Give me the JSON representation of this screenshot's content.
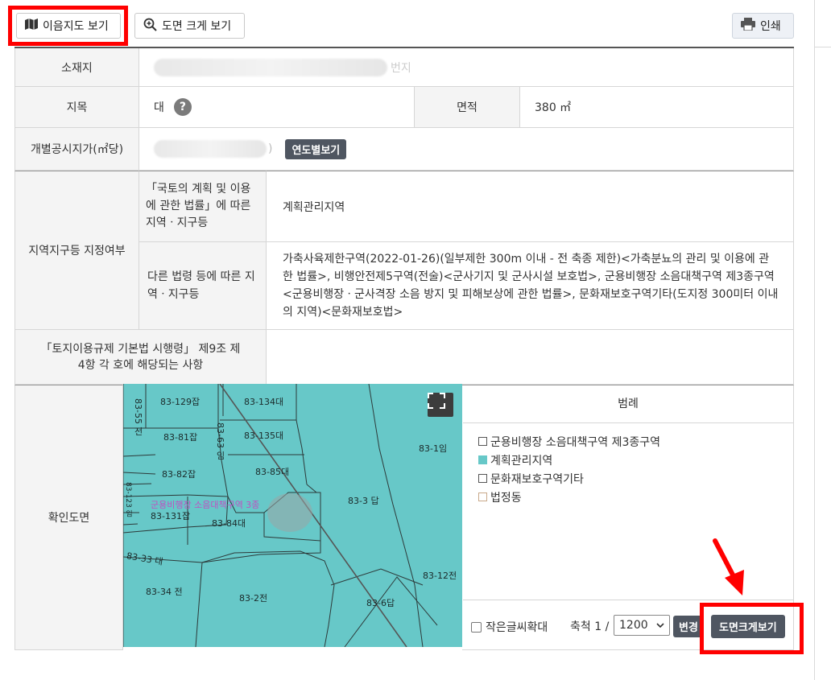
{
  "toolbar": {
    "map_button_label": "이음지도 보기",
    "zoom_button_label": "도면 크게 보기",
    "print_button_label": "인쇄"
  },
  "info": {
    "location_label": "소재지",
    "location_value_tail": "번지",
    "land_category_label": "지목",
    "land_category_value": "대",
    "help_symbol": "?",
    "area_label": "면적",
    "area_value": "380 ㎡",
    "price_label": "개별공시지가(㎡당)",
    "price_value_tail": ")",
    "yearly_button_label": "연도별보기"
  },
  "zoning": {
    "section_label": "지역지구등 지정여부",
    "national_law_label": "「국토의 계획 및 이용에 관한 법률」에 따른 지역ㆍ지구등",
    "national_law_value": "계획관리지역",
    "other_law_label": "다른 법령 등에 따른 지역ㆍ지구등",
    "other_law_value": "가축사육제한구역(2022-01-26)(일부제한 300m 이내 - 전 축종 제한)<가축분뇨의 관리 및 이용에 관한 법률>, 비행안전제5구역(전술)<군사기지 및 군사시설 보호법>, 군용비행장 소음대책구역 제3종구역<군용비행장ㆍ군사격장 소음 방지 및 피해보상에 관한 법률>, 문화재보호구역기타(도지정 300미터 이내의 지역)<문화재보호법>"
  },
  "regulation": {
    "label": "「토지이용규제 기본법 시행령」 제9조 제4항 각 호에 해당되는 사항",
    "value": ""
  },
  "map_section": {
    "label": "확인도면",
    "parcels": [
      "83-129잡",
      "83-134대",
      "83-55 전",
      "83-81잡",
      "83-135대",
      "83-63 임",
      "83-1임",
      "83-82잡",
      "83-85대",
      "83-3 답",
      "83-131잡",
      "83-84대",
      "83-33 대",
      "83-12전",
      "83-34 전",
      "83-2전",
      "83-6답",
      "83-123 임"
    ],
    "overlay_text": "군용비행장 소음대책구역 3종"
  },
  "legend": {
    "title": "범례",
    "items": [
      {
        "label": "군용비행장 소음대책구역 제3종구역",
        "swatch": "#ffffff"
      },
      {
        "label": "계획관리지역",
        "swatch": "#67c8c8"
      },
      {
        "label": "문화재보호구역기타",
        "swatch": "#ffffff"
      },
      {
        "label": "법정동",
        "swatch": "#ffffff"
      }
    ]
  },
  "controls": {
    "small_text_label": "작은글씨확대",
    "scale_label": "축척 1 /",
    "scale_value": "1200",
    "change_button_label": "변경",
    "big_view_button_label": "도면크게보기"
  },
  "colors": {
    "map_fill": "#67c8c8",
    "highlight": "#ff0000",
    "button_dark": "#4f5661"
  }
}
